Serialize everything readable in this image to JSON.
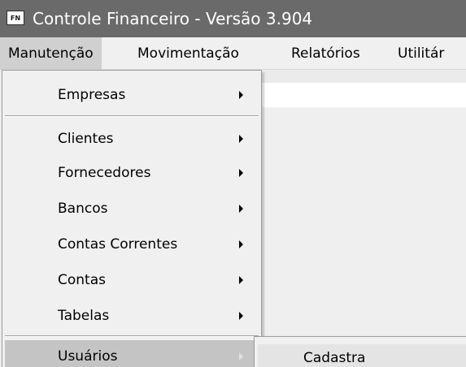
{
  "window": {
    "title": "Controle Financeiro - Versão 3.904",
    "icon_text": "FN",
    "title_bar_color": "#6a6a6a"
  },
  "menubar": {
    "items": [
      {
        "label": "Manutenção",
        "active": true
      },
      {
        "label": "Movimentação",
        "active": false
      },
      {
        "label": "Relatórios",
        "active": false
      },
      {
        "label": "Utilitár",
        "active": false
      }
    ]
  },
  "dropdown": {
    "items": [
      {
        "label": "Empresas",
        "submenu": true
      },
      {
        "label": "Clientes",
        "submenu": true
      },
      {
        "label": "Fornecedores",
        "submenu": true
      },
      {
        "label": "Bancos",
        "submenu": true
      },
      {
        "label": "Contas Correntes",
        "submenu": true
      },
      {
        "label": "Contas",
        "submenu": true
      },
      {
        "label": "Tabelas",
        "submenu": true
      },
      {
        "label": "Usuários",
        "submenu": true,
        "highlighted": true
      }
    ]
  },
  "submenu": {
    "items": [
      {
        "label": "Cadastra"
      }
    ]
  }
}
